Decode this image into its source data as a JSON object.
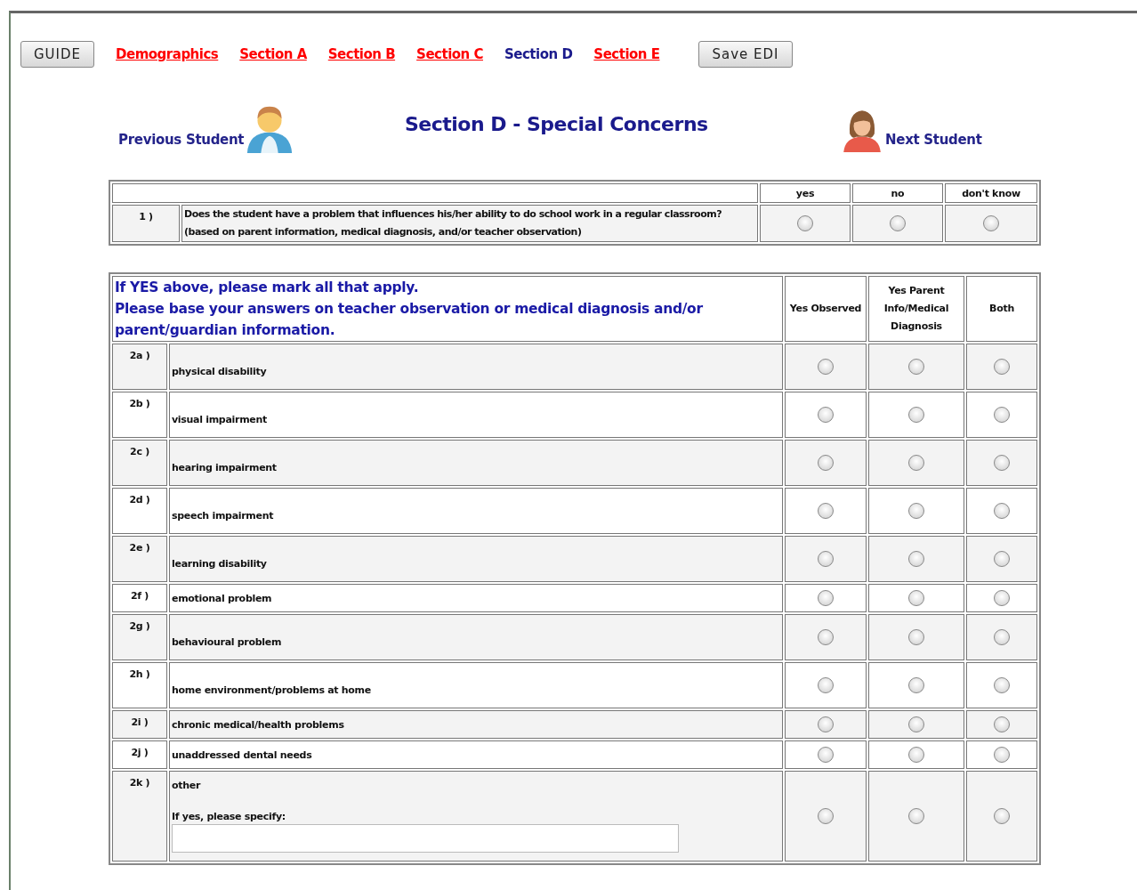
{
  "nav": {
    "guide_button": "GUIDE",
    "save_button": "Save EDI",
    "links": [
      {
        "label": "Demographics",
        "selected": false
      },
      {
        "label": "Section A",
        "selected": false
      },
      {
        "label": "Section B",
        "selected": false
      },
      {
        "label": "Section C",
        "selected": false
      },
      {
        "label": "Section D",
        "selected": true
      },
      {
        "label": "Section E",
        "selected": false
      }
    ]
  },
  "header": {
    "previous": "Previous Student",
    "title": "Section D - Special Concerns",
    "next": "Next Student"
  },
  "question1": {
    "columns": [
      "yes",
      "no",
      "don't know"
    ],
    "number": "1 )",
    "lines": [
      "Does the student have a problem that influences his/her ability to do school work in a regular classroom?",
      "(based on parent information, medical diagnosis, and/or teacher observation)"
    ],
    "options": [
      {
        "selected": false
      },
      {
        "selected": false
      },
      {
        "selected": false
      }
    ]
  },
  "question2": {
    "intro": [
      "If YES above, please mark all that apply.",
      "Please base your answers on teacher observation or medical diagnosis and/or parent/guardian information."
    ],
    "columns": [
      "Yes Observed",
      "Yes Parent Info/Medical Diagnosis",
      "Both"
    ],
    "rows": [
      {
        "number": "2a )",
        "label": "physical disability",
        "kind": "tall",
        "options": [
          {
            "selected": false
          },
          {
            "selected": false
          },
          {
            "selected": false
          }
        ]
      },
      {
        "number": "2b )",
        "label": "visual impairment",
        "kind": "tall",
        "options": [
          {
            "selected": false
          },
          {
            "selected": false
          },
          {
            "selected": false
          }
        ]
      },
      {
        "number": "2c )",
        "label": "hearing impairment",
        "kind": "tall",
        "options": [
          {
            "selected": false
          },
          {
            "selected": false
          },
          {
            "selected": false
          }
        ]
      },
      {
        "number": "2d )",
        "label": "speech impairment",
        "kind": "tall",
        "options": [
          {
            "selected": false
          },
          {
            "selected": false
          },
          {
            "selected": false
          }
        ]
      },
      {
        "number": "2e )",
        "label": "learning disability",
        "kind": "tall",
        "options": [
          {
            "selected": false
          },
          {
            "selected": false
          },
          {
            "selected": false
          }
        ]
      },
      {
        "number": "2f )",
        "label": "emotional problem",
        "kind": "short",
        "options": [
          {
            "selected": false
          },
          {
            "selected": false
          },
          {
            "selected": false
          }
        ]
      },
      {
        "number": "2g )",
        "label": "behavioural problem",
        "kind": "tall",
        "options": [
          {
            "selected": false
          },
          {
            "selected": false
          },
          {
            "selected": false
          }
        ]
      },
      {
        "number": "2h )",
        "label": "home environment/problems at home",
        "kind": "tall",
        "options": [
          {
            "selected": false
          },
          {
            "selected": false
          },
          {
            "selected": false
          }
        ]
      },
      {
        "number": "2i )",
        "label": "chronic medical/health problems",
        "kind": "short",
        "options": [
          {
            "selected": false
          },
          {
            "selected": false
          },
          {
            "selected": false
          }
        ]
      },
      {
        "number": "2j )",
        "label": "unaddressed dental needs",
        "kind": "short",
        "options": [
          {
            "selected": false
          },
          {
            "selected": false
          },
          {
            "selected": false
          }
        ]
      },
      {
        "number": "2k )",
        "label": "other",
        "kind": "specify",
        "specify_label": "If yes, please specify:",
        "options": [
          {
            "selected": false
          },
          {
            "selected": false
          },
          {
            "selected": false
          }
        ]
      }
    ]
  }
}
